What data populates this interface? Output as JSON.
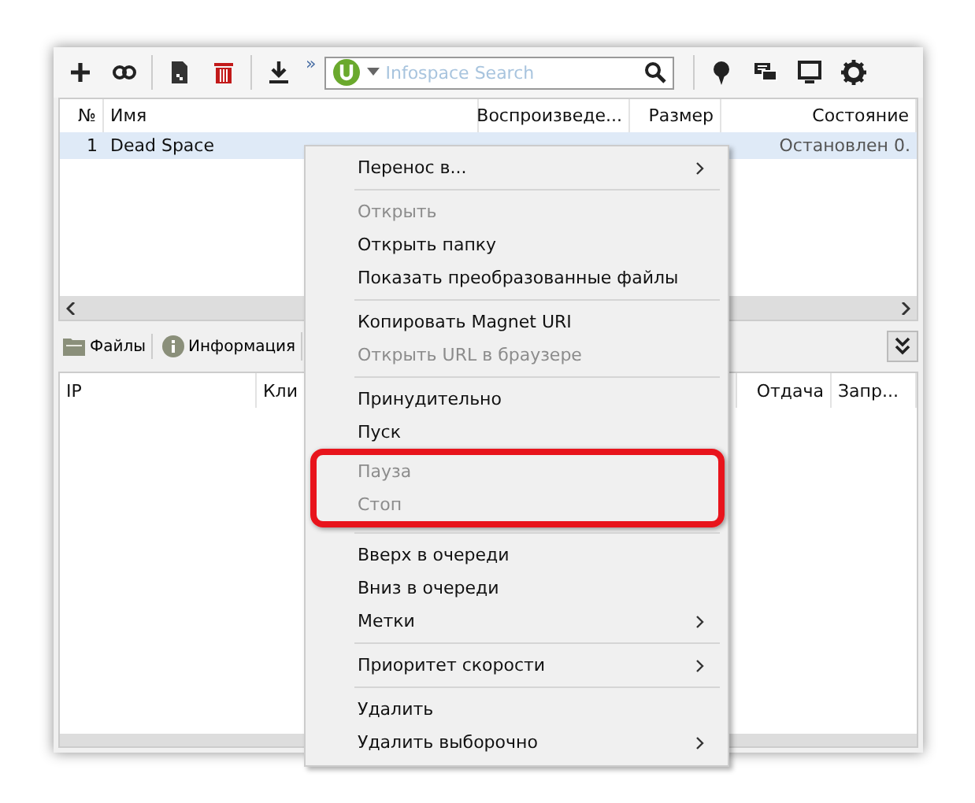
{
  "toolbar": {
    "search": {
      "placeholder": "Infospace Search"
    },
    "overflow": "»"
  },
  "torrents": {
    "columns": [
      "№",
      "Имя",
      "Воспроизведе...",
      "Размер",
      "Состояние"
    ],
    "rows": [
      {
        "cells": [
          "1",
          "Dead Space",
          "",
          "",
          "Остановлен 0."
        ],
        "selected": true
      }
    ]
  },
  "detail_tabs": [
    {
      "label": "Файлы"
    },
    {
      "label": "Информация"
    }
  ],
  "peers": {
    "columns": [
      "IP",
      "Кли",
      "Отдача",
      "Запр..."
    ]
  },
  "context_menu": [
    {
      "kind": "item",
      "label": "Перенос в...",
      "disabled": false,
      "submenu": true,
      "highlighted": false
    },
    {
      "kind": "separator"
    },
    {
      "kind": "item",
      "label": "Открыть",
      "disabled": true,
      "submenu": false,
      "highlighted": false
    },
    {
      "kind": "item",
      "label": "Открыть папку",
      "disabled": false,
      "submenu": false,
      "highlighted": false
    },
    {
      "kind": "item",
      "label": "Показать преобразованные файлы",
      "disabled": false,
      "submenu": false,
      "highlighted": false
    },
    {
      "kind": "separator"
    },
    {
      "kind": "item",
      "label": "Копировать Magnet URI",
      "disabled": false,
      "submenu": false,
      "highlighted": false
    },
    {
      "kind": "item",
      "label": "Открыть URL в браузере",
      "disabled": true,
      "submenu": false,
      "highlighted": false
    },
    {
      "kind": "separator"
    },
    {
      "kind": "item",
      "label": "Принудительно",
      "disabled": false,
      "submenu": false,
      "highlighted": false
    },
    {
      "kind": "item",
      "label": "Пуск",
      "disabled": false,
      "submenu": false,
      "highlighted": false
    },
    {
      "kind": "item",
      "label": "Пауза",
      "disabled": true,
      "submenu": false,
      "highlighted": true
    },
    {
      "kind": "item",
      "label": "Стоп",
      "disabled": true,
      "submenu": false,
      "highlighted": true
    },
    {
      "kind": "separator"
    },
    {
      "kind": "item",
      "label": "Вверх в очереди",
      "disabled": false,
      "submenu": false,
      "highlighted": false
    },
    {
      "kind": "item",
      "label": "Вниз в очереди",
      "disabled": false,
      "submenu": false,
      "highlighted": false
    },
    {
      "kind": "item",
      "label": "Метки",
      "disabled": false,
      "submenu": true,
      "highlighted": false
    },
    {
      "kind": "separator"
    },
    {
      "kind": "item",
      "label": "Приоритет скорости",
      "disabled": false,
      "submenu": true,
      "highlighted": false
    },
    {
      "kind": "separator"
    },
    {
      "kind": "item",
      "label": "Удалить",
      "disabled": false,
      "submenu": false,
      "highlighted": false
    },
    {
      "kind": "item",
      "label": "Удалить выборочно",
      "disabled": false,
      "submenu": true,
      "highlighted": false
    }
  ]
}
